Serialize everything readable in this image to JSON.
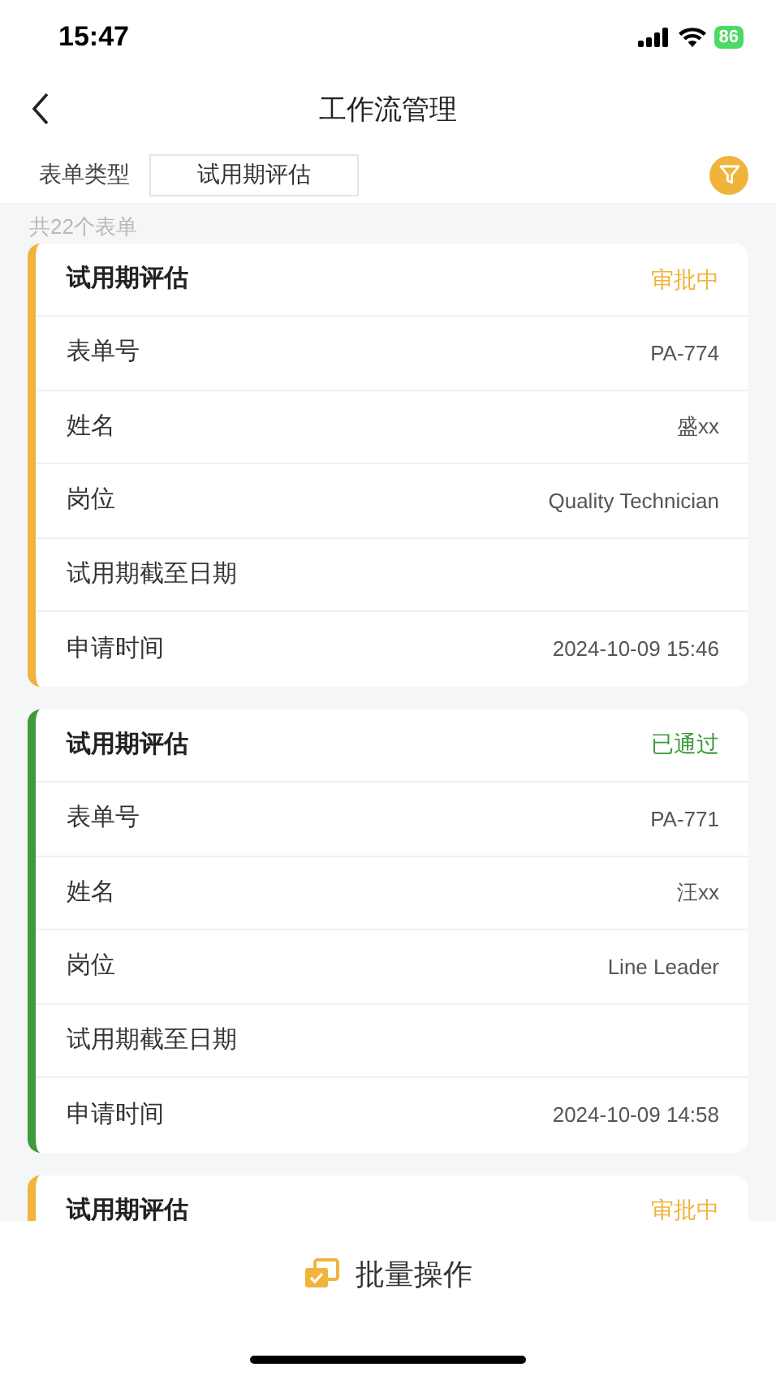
{
  "status_bar": {
    "time": "15:47",
    "battery": "86"
  },
  "header": {
    "title": "工作流管理"
  },
  "filter": {
    "label": "表单类型",
    "value": "试用期评估"
  },
  "count": "共22个表单",
  "cards": [
    {
      "title": "试用期评估",
      "status": "审批中",
      "color": "#f0b43c",
      "fields": [
        {
          "label": "表单号",
          "value": "PA-774"
        },
        {
          "label": "姓名",
          "value": "盛xx"
        },
        {
          "label": "岗位",
          "value": "Quality Technician"
        },
        {
          "label": "试用期截至日期"
        },
        {
          "label": "申请时间",
          "value": "2024-10-09 15:46"
        }
      ]
    },
    {
      "title": "试用期评估",
      "status": "已通过",
      "color": "#3f9a3c",
      "fields": [
        {
          "label": "表单号",
          "value": "PA-771"
        },
        {
          "label": "姓名",
          "value": "汪xx"
        },
        {
          "label": "岗位",
          "value": "Line Leader"
        },
        {
          "label": "试用期截至日期"
        },
        {
          "label": "申请时间",
          "value": "2024-10-09 14:58"
        }
      ]
    },
    {
      "title": "试用期评估",
      "status": "审批中",
      "color": "#f0b43c"
    }
  ],
  "batch_button": {
    "label": "批量操作"
  }
}
